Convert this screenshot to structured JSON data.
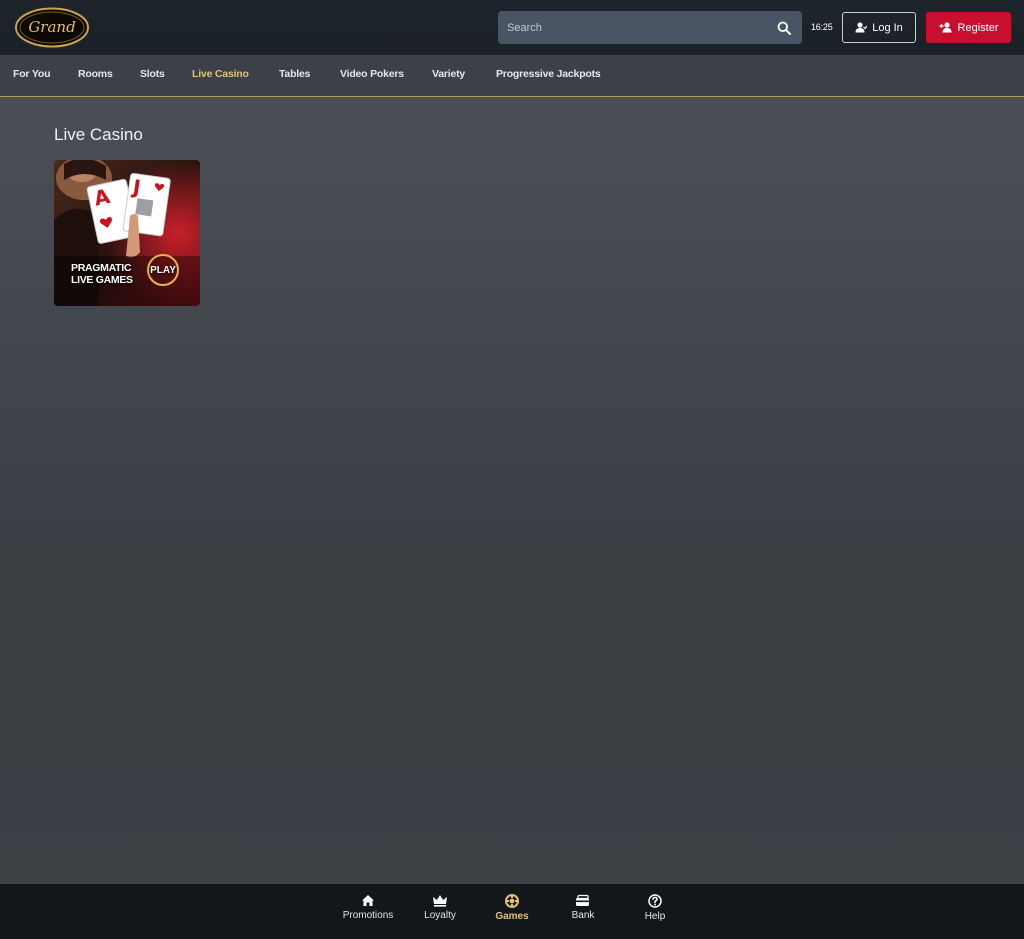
{
  "header": {
    "logo_text": "Grand",
    "search": {
      "placeholder": "Search"
    },
    "clock": "16:25",
    "login_label": "Log In",
    "register_label": "Register"
  },
  "category_nav": {
    "items": [
      {
        "label": "For You"
      },
      {
        "label": "Rooms"
      },
      {
        "label": "Slots"
      },
      {
        "label": "Live Casino",
        "active": true
      },
      {
        "label": "Tables"
      },
      {
        "label": "Video Pokers"
      },
      {
        "label": "Variety"
      },
      {
        "label": "Progressive Jackpots"
      }
    ]
  },
  "main": {
    "section_title": "Live Casino",
    "games": [
      {
        "line1": "PRAGMATIC",
        "line2": "LIVE GAMES",
        "badge": "PLAY",
        "card1": "A",
        "card2": "J"
      }
    ]
  },
  "bottom_nav": {
    "items": [
      {
        "label": "Promotions",
        "icon": "home-icon"
      },
      {
        "label": "Loyalty",
        "icon": "crown-icon"
      },
      {
        "label": "Games",
        "icon": "games-icon",
        "active": true
      },
      {
        "label": "Bank",
        "icon": "bank-icon"
      },
      {
        "label": "Help",
        "icon": "help-icon"
      }
    ]
  },
  "colors": {
    "accent_gold": "#e3c274",
    "register_red": "#c8102e",
    "background": "#3b3f44"
  }
}
